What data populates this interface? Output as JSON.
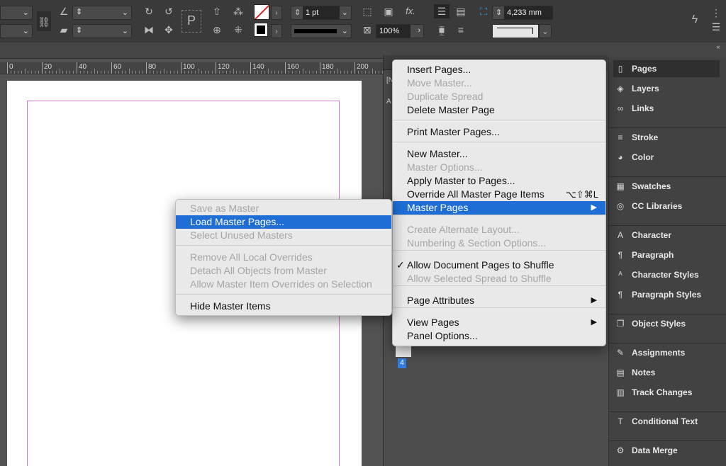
{
  "toolbar": {
    "stroke_weight": "1 pt",
    "zoom": "100%",
    "size_value": "4,233 mm",
    "fx_label": "fx.",
    "p_label": "P"
  },
  "ruler": {
    "ticks": [
      "0",
      "20",
      "40",
      "60",
      "80",
      "100",
      "120",
      "140",
      "160",
      "180",
      "200"
    ]
  },
  "panel": {
    "tab_partial": "[N",
    "a_label": "A",
    "page_number": "4"
  },
  "pages_menu": {
    "items": [
      {
        "label": "Insert Pages...",
        "disabled": false
      },
      {
        "label": "Move Master...",
        "disabled": true
      },
      {
        "label": "Duplicate Spread",
        "disabled": true
      },
      {
        "label": "Delete Master Page",
        "disabled": false
      },
      {
        "label": "Print Master Pages...",
        "disabled": false
      },
      {
        "label": "New Master...",
        "disabled": false
      },
      {
        "label": "Master Options...",
        "disabled": true
      },
      {
        "label": "Apply Master to Pages...",
        "disabled": false
      },
      {
        "label": "Override All Master Page Items",
        "disabled": false,
        "shortcut": "⌥⇧⌘L"
      },
      {
        "label": "Master Pages",
        "disabled": false,
        "highlighted": true
      },
      {
        "label": "Create Alternate Layout...",
        "disabled": true
      },
      {
        "label": "Numbering & Section Options...",
        "disabled": true
      },
      {
        "label": "Allow Document Pages to Shuffle",
        "disabled": false,
        "checked": true
      },
      {
        "label": "Allow Selected Spread to Shuffle",
        "disabled": true
      },
      {
        "label": "Page Attributes",
        "disabled": false
      },
      {
        "label": "View Pages",
        "disabled": false
      },
      {
        "label": "Panel Options...",
        "disabled": false
      }
    ]
  },
  "submenu": {
    "items": [
      {
        "label": "Save as Master",
        "disabled": true
      },
      {
        "label": "Load Master Pages...",
        "disabled": false,
        "highlighted": true
      },
      {
        "label": "Select Unused Masters",
        "disabled": true
      },
      {
        "label": "Remove All Local Overrides",
        "disabled": true
      },
      {
        "label": "Detach All Objects from Master",
        "disabled": true
      },
      {
        "label": "Allow Master Item Overrides on Selection",
        "disabled": true
      },
      {
        "label": "Hide Master Items",
        "disabled": false
      }
    ]
  },
  "dock": {
    "items": [
      {
        "label": "Pages",
        "icon": "pages-icon"
      },
      {
        "label": "Layers",
        "icon": "layers-icon"
      },
      {
        "label": "Links",
        "icon": "links-icon"
      },
      {
        "label": "Stroke",
        "icon": "stroke-icon"
      },
      {
        "label": "Color",
        "icon": "color-icon"
      },
      {
        "label": "Swatches",
        "icon": "swatches-icon"
      },
      {
        "label": "CC Libraries",
        "icon": "cc-libraries-icon"
      },
      {
        "label": "Character",
        "icon": "character-icon"
      },
      {
        "label": "Paragraph",
        "icon": "paragraph-icon"
      },
      {
        "label": "Character Styles",
        "icon": "character-styles-icon"
      },
      {
        "label": "Paragraph Styles",
        "icon": "paragraph-styles-icon"
      },
      {
        "label": "Object Styles",
        "icon": "object-styles-icon"
      },
      {
        "label": "Assignments",
        "icon": "assignments-icon"
      },
      {
        "label": "Notes",
        "icon": "notes-icon"
      },
      {
        "label": "Track Changes",
        "icon": "track-changes-icon"
      },
      {
        "label": "Conditional Text",
        "icon": "conditional-text-icon"
      },
      {
        "label": "Data Merge",
        "icon": "data-merge-icon"
      }
    ]
  },
  "colors": {
    "highlight": "#1e6ed5",
    "margin_guide": "#d47bd5"
  }
}
